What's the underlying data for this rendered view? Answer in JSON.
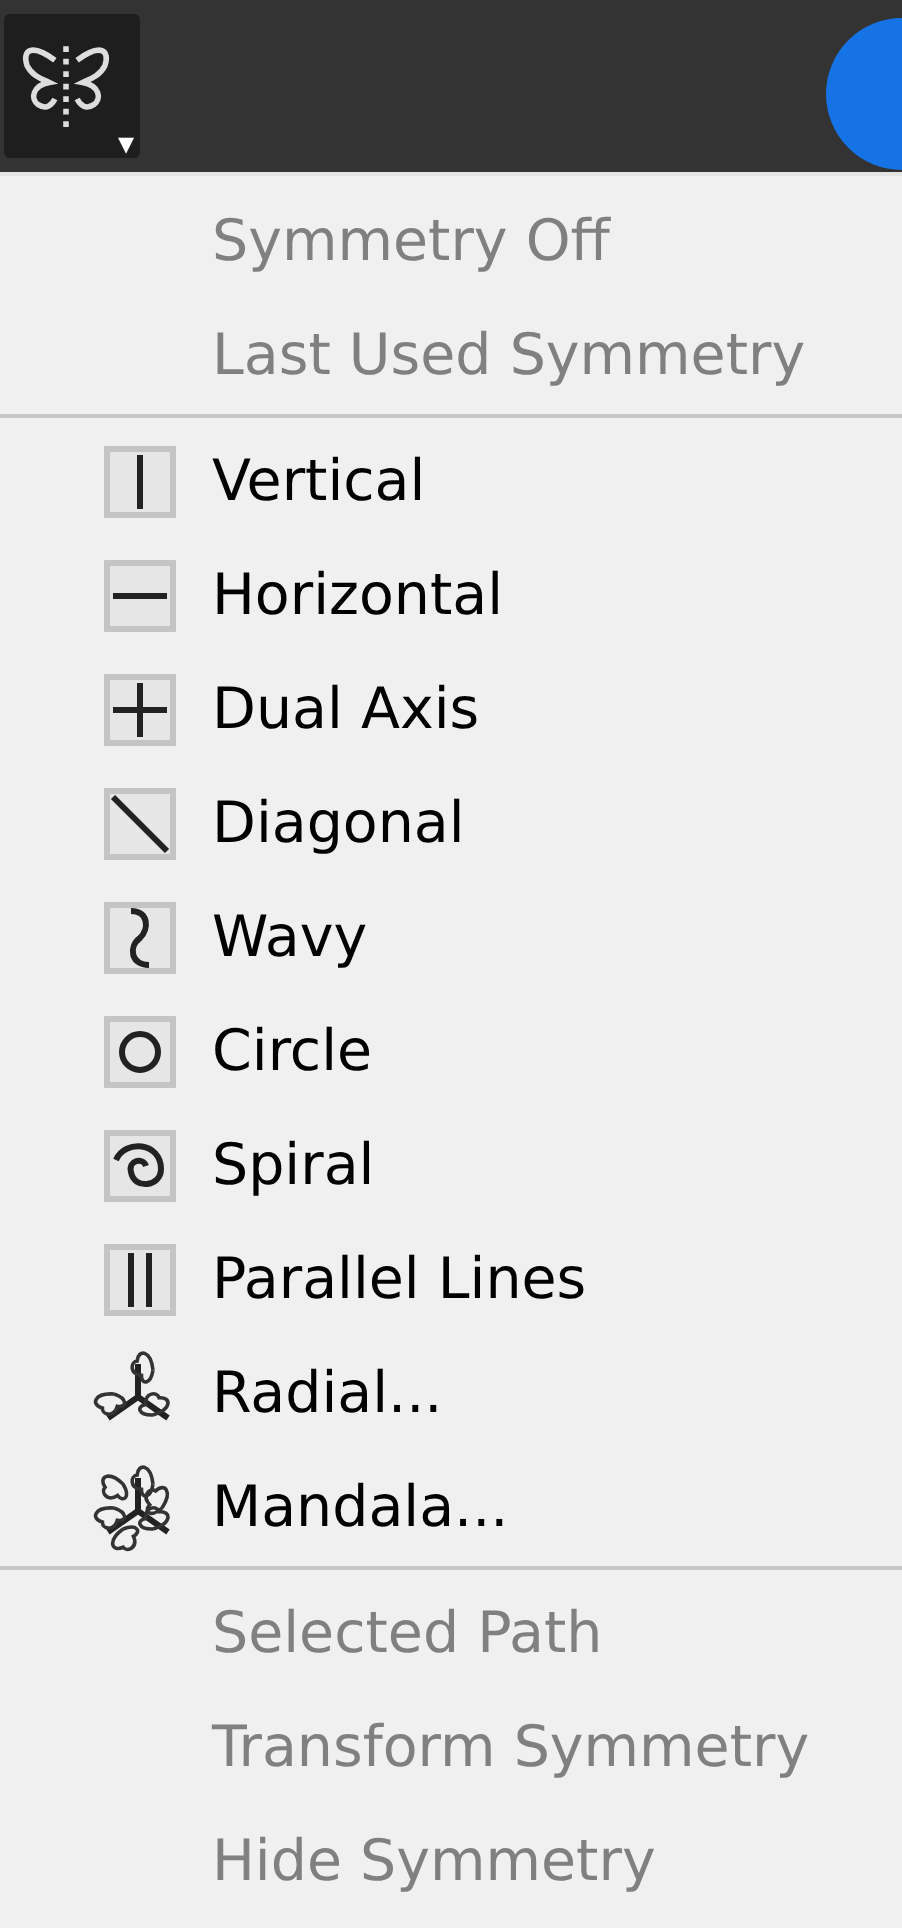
{
  "toolbar": {
    "symmetry_button": {
      "caret": "▾"
    }
  },
  "menu": {
    "groups": [
      {
        "items": [
          {
            "label": "Symmetry Off",
            "kind": "plain",
            "disabled": true
          },
          {
            "label": "Last Used Symmetry",
            "kind": "plain",
            "disabled": true
          }
        ]
      },
      {
        "items": [
          {
            "label": "Vertical",
            "kind": "vertical",
            "disabled": false
          },
          {
            "label": "Horizontal",
            "kind": "horizontal",
            "disabled": false
          },
          {
            "label": "Dual Axis",
            "kind": "dual",
            "disabled": false
          },
          {
            "label": "Diagonal",
            "kind": "diagonal",
            "disabled": false
          },
          {
            "label": "Wavy",
            "kind": "wavy",
            "disabled": false
          },
          {
            "label": "Circle",
            "kind": "circle",
            "disabled": false
          },
          {
            "label": "Spiral",
            "kind": "spiral",
            "disabled": false
          },
          {
            "label": "Parallel Lines",
            "kind": "parallel",
            "disabled": false
          },
          {
            "label": "Radial...",
            "kind": "radial",
            "disabled": false
          },
          {
            "label": "Mandala...",
            "kind": "mandala",
            "disabled": false
          }
        ]
      },
      {
        "items": [
          {
            "label": "Selected Path",
            "kind": "plain",
            "disabled": true
          },
          {
            "label": "Transform Symmetry",
            "kind": "plain",
            "disabled": true
          },
          {
            "label": "Hide Symmetry",
            "kind": "plain",
            "disabled": true
          }
        ]
      }
    ]
  }
}
